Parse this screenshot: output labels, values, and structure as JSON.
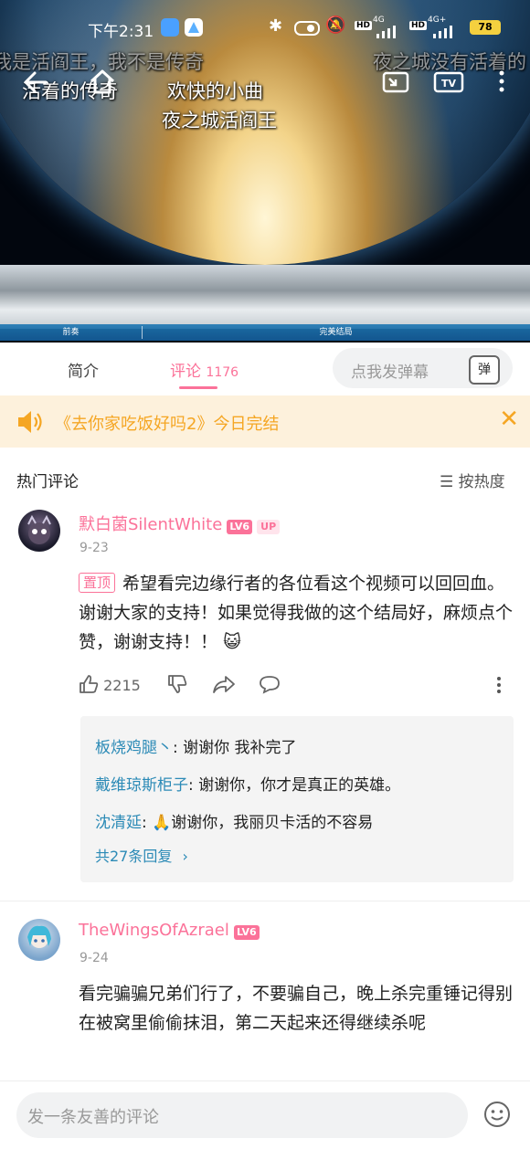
{
  "status_bar": {
    "time": "下午2:31",
    "battery": "78",
    "network_1": "4G",
    "network_2": "4G+"
  },
  "video": {
    "danmaku": [
      "我是活阎王，我不是传奇",
      "夜之城没有活着的",
      "活着的传奇",
      "欢快的小曲",
      "夜之城活阎王"
    ],
    "segments": [
      "前奏",
      "完美结局"
    ]
  },
  "tabs": {
    "intro": "简介",
    "comments": "评论",
    "comment_count": "1176",
    "danmaku_placeholder": "点我发弹幕",
    "danmaku_button": "弹"
  },
  "notice": {
    "text": "《去你家吃饭好吗2》今日完结"
  },
  "comments_header": {
    "title": "热门评论",
    "sort_label": "按热度"
  },
  "comments": [
    {
      "username": "默白菌SilentWhite",
      "level": "LV6",
      "up_badge": "UP",
      "date": "9-23",
      "pin_label": "置顶",
      "text": "希望看完边缘行者的各位看这个视频可以回回血。谢谢大家的支持！如果觉得我做的这个结局好，麻烦点个赞，谢谢支持！！",
      "likes": "2215",
      "replies": [
        {
          "name": "板烧鸡腿丶",
          "text": ": 谢谢你 我补完了"
        },
        {
          "name": "戴维琼斯柜子",
          "text": ": 谢谢你，你才是真正的英雄。"
        },
        {
          "name": "沈清延",
          "text": ": 🙏谢谢你，我丽贝卡活的不容易"
        }
      ],
      "more_replies": "共27条回复"
    },
    {
      "username": "TheWingsOfAzrael",
      "level": "LV6",
      "date": "9-24",
      "text": "看完骗骗兄弟们行了，不要骗自己，晚上杀完重锤记得别在被窝里偷偷抹泪，第二天起来还得继续杀呢"
    }
  ],
  "bottom_bar": {
    "placeholder": "发一条友善的评论"
  },
  "colors": {
    "accent": "#fb7299",
    "notice": "#f5a623",
    "reply_name": "#2b8ab6"
  }
}
